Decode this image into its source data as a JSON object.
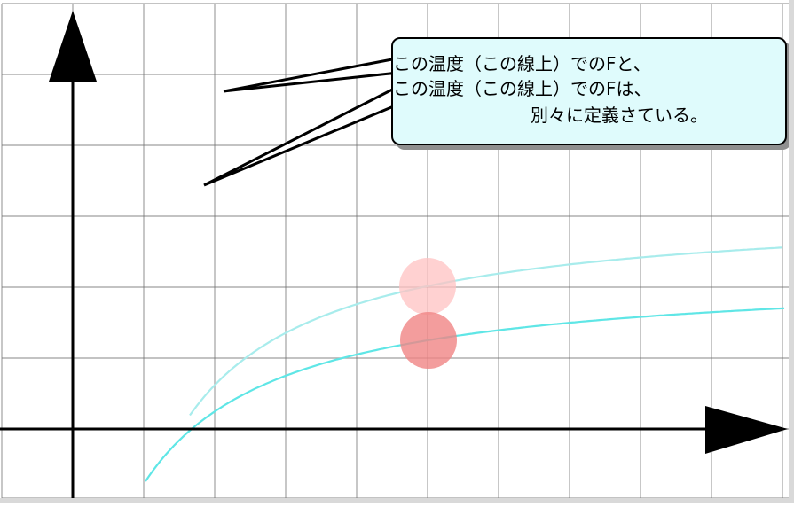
{
  "callout": {
    "lines": [
      "この温度（この線上）でのFと、",
      "この温度（この線上）でのFは、",
      "別々に定義さている。"
    ]
  },
  "colors": {
    "grid": "#6e6e6e",
    "axes": "#000000",
    "curve_dark": "#5fe6e6",
    "curve_light": "#a8ecec",
    "point_light": "#ffc2c2",
    "point_dark": "#f08484",
    "callout_fill": "#dffbfc",
    "callout_shadow": "#8f8f8f"
  },
  "icons": {
    "y_axis_arrow": "triangle-up-icon",
    "x_axis_arrow": "triangle-right-icon"
  }
}
